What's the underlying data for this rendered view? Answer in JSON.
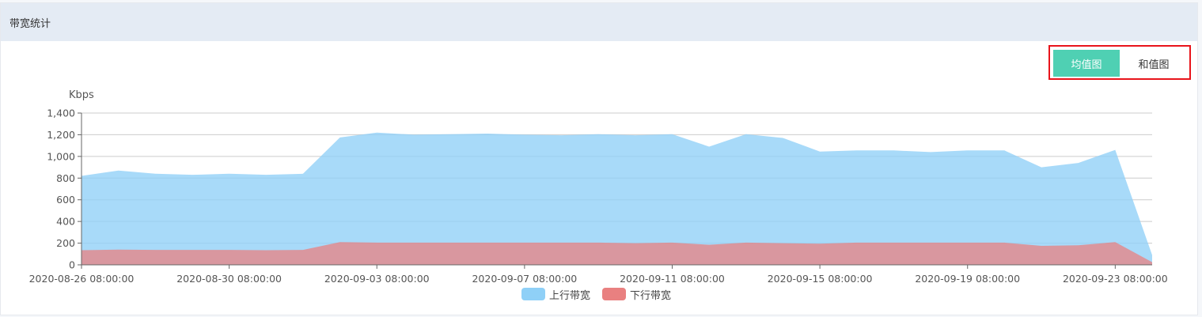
{
  "panel": {
    "title": "带宽统计"
  },
  "toggle": {
    "avg_label": "均值图",
    "sum_label": "和值图",
    "active": "avg"
  },
  "colors": {
    "upstream": "#8fd0f7",
    "downstream": "#e98080",
    "active_button": "#4fd0b3",
    "highlight_border": "#e8141b",
    "header_bg": "#e4ebf4"
  },
  "chart_data": {
    "type": "area",
    "ylabel": "Kbps",
    "ylim": [
      0,
      1400
    ],
    "yticks": [
      0,
      200,
      400,
      600,
      800,
      1000,
      1200,
      1400
    ],
    "ytick_labels": [
      "0",
      "200",
      "400",
      "600",
      "800",
      "1,000",
      "1,200",
      "1,400"
    ],
    "x": [
      "2020-08-26 08:00:00",
      "2020-08-27 08:00:00",
      "2020-08-28 08:00:00",
      "2020-08-29 08:00:00",
      "2020-08-30 08:00:00",
      "2020-08-31 08:00:00",
      "2020-09-01 08:00:00",
      "2020-09-02 08:00:00",
      "2020-09-03 08:00:00",
      "2020-09-04 08:00:00",
      "2020-09-05 08:00:00",
      "2020-09-06 08:00:00",
      "2020-09-07 08:00:00",
      "2020-09-08 08:00:00",
      "2020-09-09 08:00:00",
      "2020-09-10 08:00:00",
      "2020-09-11 08:00:00",
      "2020-09-12 08:00:00",
      "2020-09-13 08:00:00",
      "2020-09-14 08:00:00",
      "2020-09-15 08:00:00",
      "2020-09-16 08:00:00",
      "2020-09-17 08:00:00",
      "2020-09-18 08:00:00",
      "2020-09-19 08:00:00",
      "2020-09-20 08:00:00",
      "2020-09-21 08:00:00",
      "2020-09-22 08:00:00",
      "2020-09-23 08:00:00",
      "2020-09-24 08:00:00"
    ],
    "xtick_labels": [
      "2020-08-26 08:00:00",
      "2020-08-30 08:00:00",
      "2020-09-03 08:00:00",
      "2020-09-07 08:00:00",
      "2020-09-11 08:00:00",
      "2020-09-15 08:00:00",
      "2020-09-19 08:00:00",
      "2020-09-23 08:00:00"
    ],
    "series": [
      {
        "name": "上行带宽",
        "values": [
          820,
          870,
          840,
          830,
          840,
          830,
          840,
          1175,
          1220,
          1200,
          1205,
          1210,
          1200,
          1195,
          1205,
          1195,
          1205,
          1090,
          1205,
          1170,
          1045,
          1055,
          1055,
          1040,
          1055,
          1055,
          900,
          940,
          1060,
          90
        ]
      },
      {
        "name": "下行带宽",
        "values": [
          135,
          140,
          138,
          138,
          138,
          135,
          138,
          210,
          205,
          205,
          205,
          205,
          205,
          205,
          205,
          200,
          205,
          185,
          205,
          200,
          195,
          205,
          205,
          205,
          205,
          205,
          175,
          180,
          210,
          25
        ]
      }
    ],
    "grid": true,
    "legend_position": "bottom-center"
  }
}
